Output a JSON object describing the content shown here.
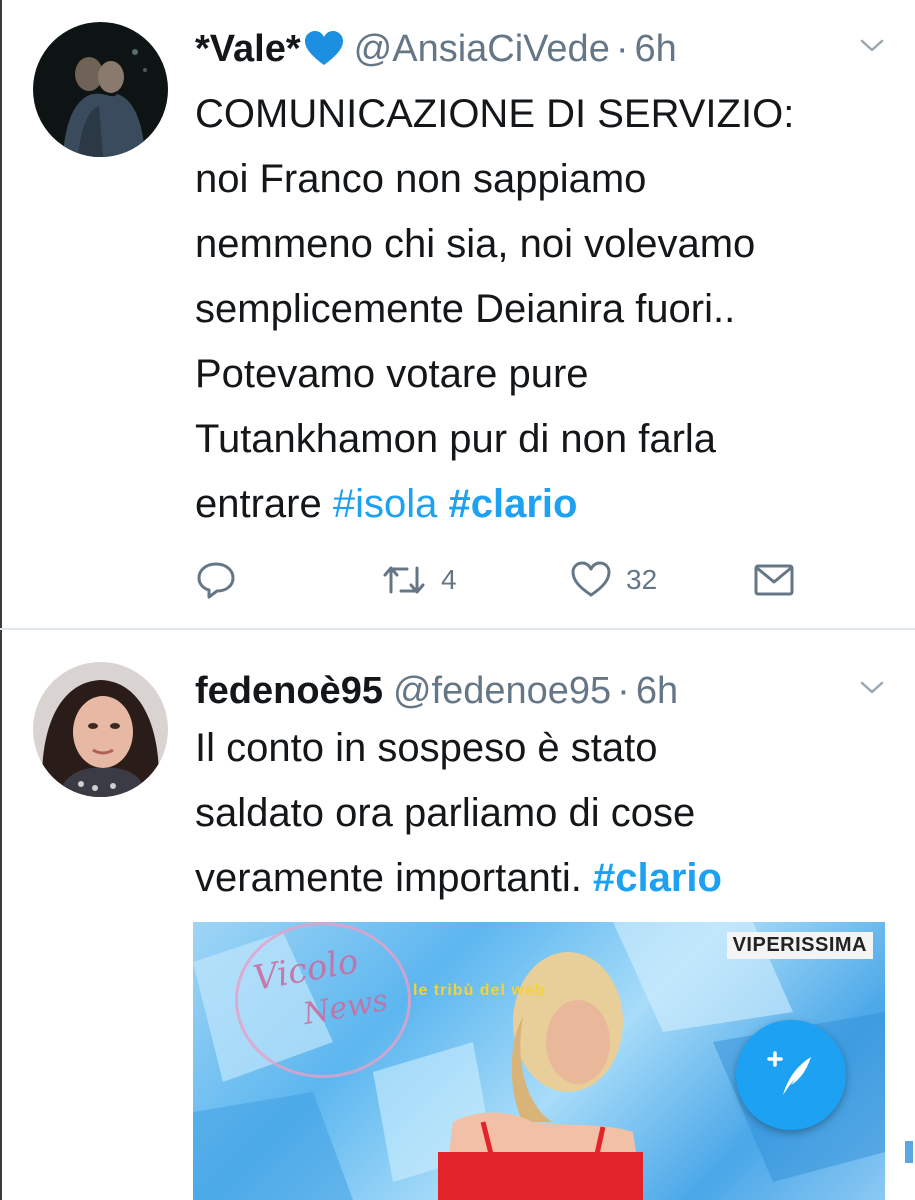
{
  "tweets": [
    {
      "display_name": "*Vale*",
      "handle": "@AnsiaCiVede",
      "separator": "·",
      "time": "6h",
      "text_lines": [
        "COMUNICAZIONE DI SERVIZIO:",
        "noi Franco non sappiamo",
        "nemmeno chi sia, noi volevamo",
        "semplicemente Deianira fuori..",
        "Potevamo votare pure",
        "Tutankhamon pur di non farla"
      ],
      "last_line_text": "entrare",
      "hashtags": [
        "#isola",
        "#clario"
      ],
      "actions": {
        "retweets": "4",
        "likes": "32"
      }
    },
    {
      "display_name": "fedenoè95",
      "handle": "@fedenoe95",
      "separator": "·",
      "time": "6h",
      "text_lines": [
        "Il conto in sospeso è stato",
        "saldato ora parliamo di cose"
      ],
      "last_line_text": "veramente importanti.",
      "hashtags": [
        "#clario"
      ],
      "media": {
        "badge": "VIPERISSIMA",
        "watermark_line1": "Vicolo",
        "watermark_line2": "News",
        "watermark2": "le tribù del web"
      }
    }
  ],
  "colors": {
    "link": "#1da1f2",
    "muted": "#657786",
    "heart_emoji": "#1d8fe0",
    "fab": "#1da1f2"
  },
  "icons": [
    "reply-icon",
    "retweet-icon",
    "like-icon",
    "dm-icon",
    "chevron-down-icon",
    "compose-tweet-icon",
    "blue-heart-icon"
  ]
}
